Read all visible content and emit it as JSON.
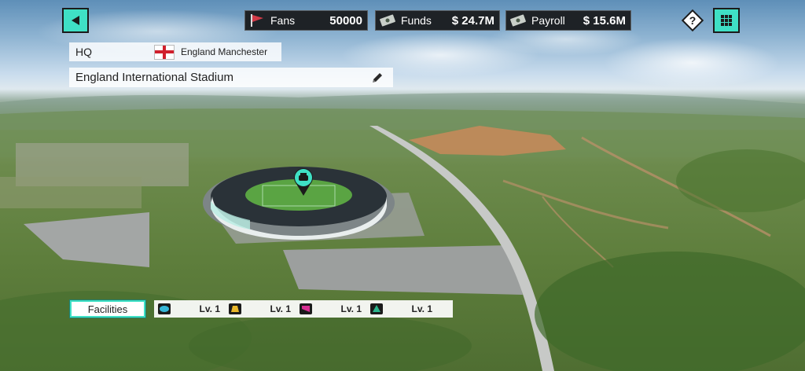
{
  "topbar": {
    "fans": {
      "label": "Fans",
      "value": "50000",
      "icon": "pennant-icon"
    },
    "funds": {
      "label": "Funds",
      "value": "$ 24.7M",
      "icon": "banknote-icon"
    },
    "payroll": {
      "label": "Payroll",
      "value": "$ 15.6M",
      "icon": "banknote-icon"
    },
    "help_glyph": "?"
  },
  "hq": {
    "label": "HQ",
    "location": "England Manchester",
    "flag": "england-flag-icon",
    "stadium_name": "England International Stadium"
  },
  "facilities": {
    "button_label": "Facilities",
    "items": [
      {
        "icon": "facility-1-icon",
        "color": "#35b6d6",
        "level": "Lv. 1"
      },
      {
        "icon": "facility-2-icon",
        "color": "#e9b72a",
        "level": "Lv. 1"
      },
      {
        "icon": "facility-3-icon",
        "color": "#d72f93",
        "level": "Lv. 1"
      },
      {
        "icon": "facility-4-icon",
        "color": "#2bb58c",
        "level": "Lv. 1"
      }
    ]
  },
  "colors": {
    "accent": "#3fe0c5",
    "bar_dark": "#1e2226"
  }
}
